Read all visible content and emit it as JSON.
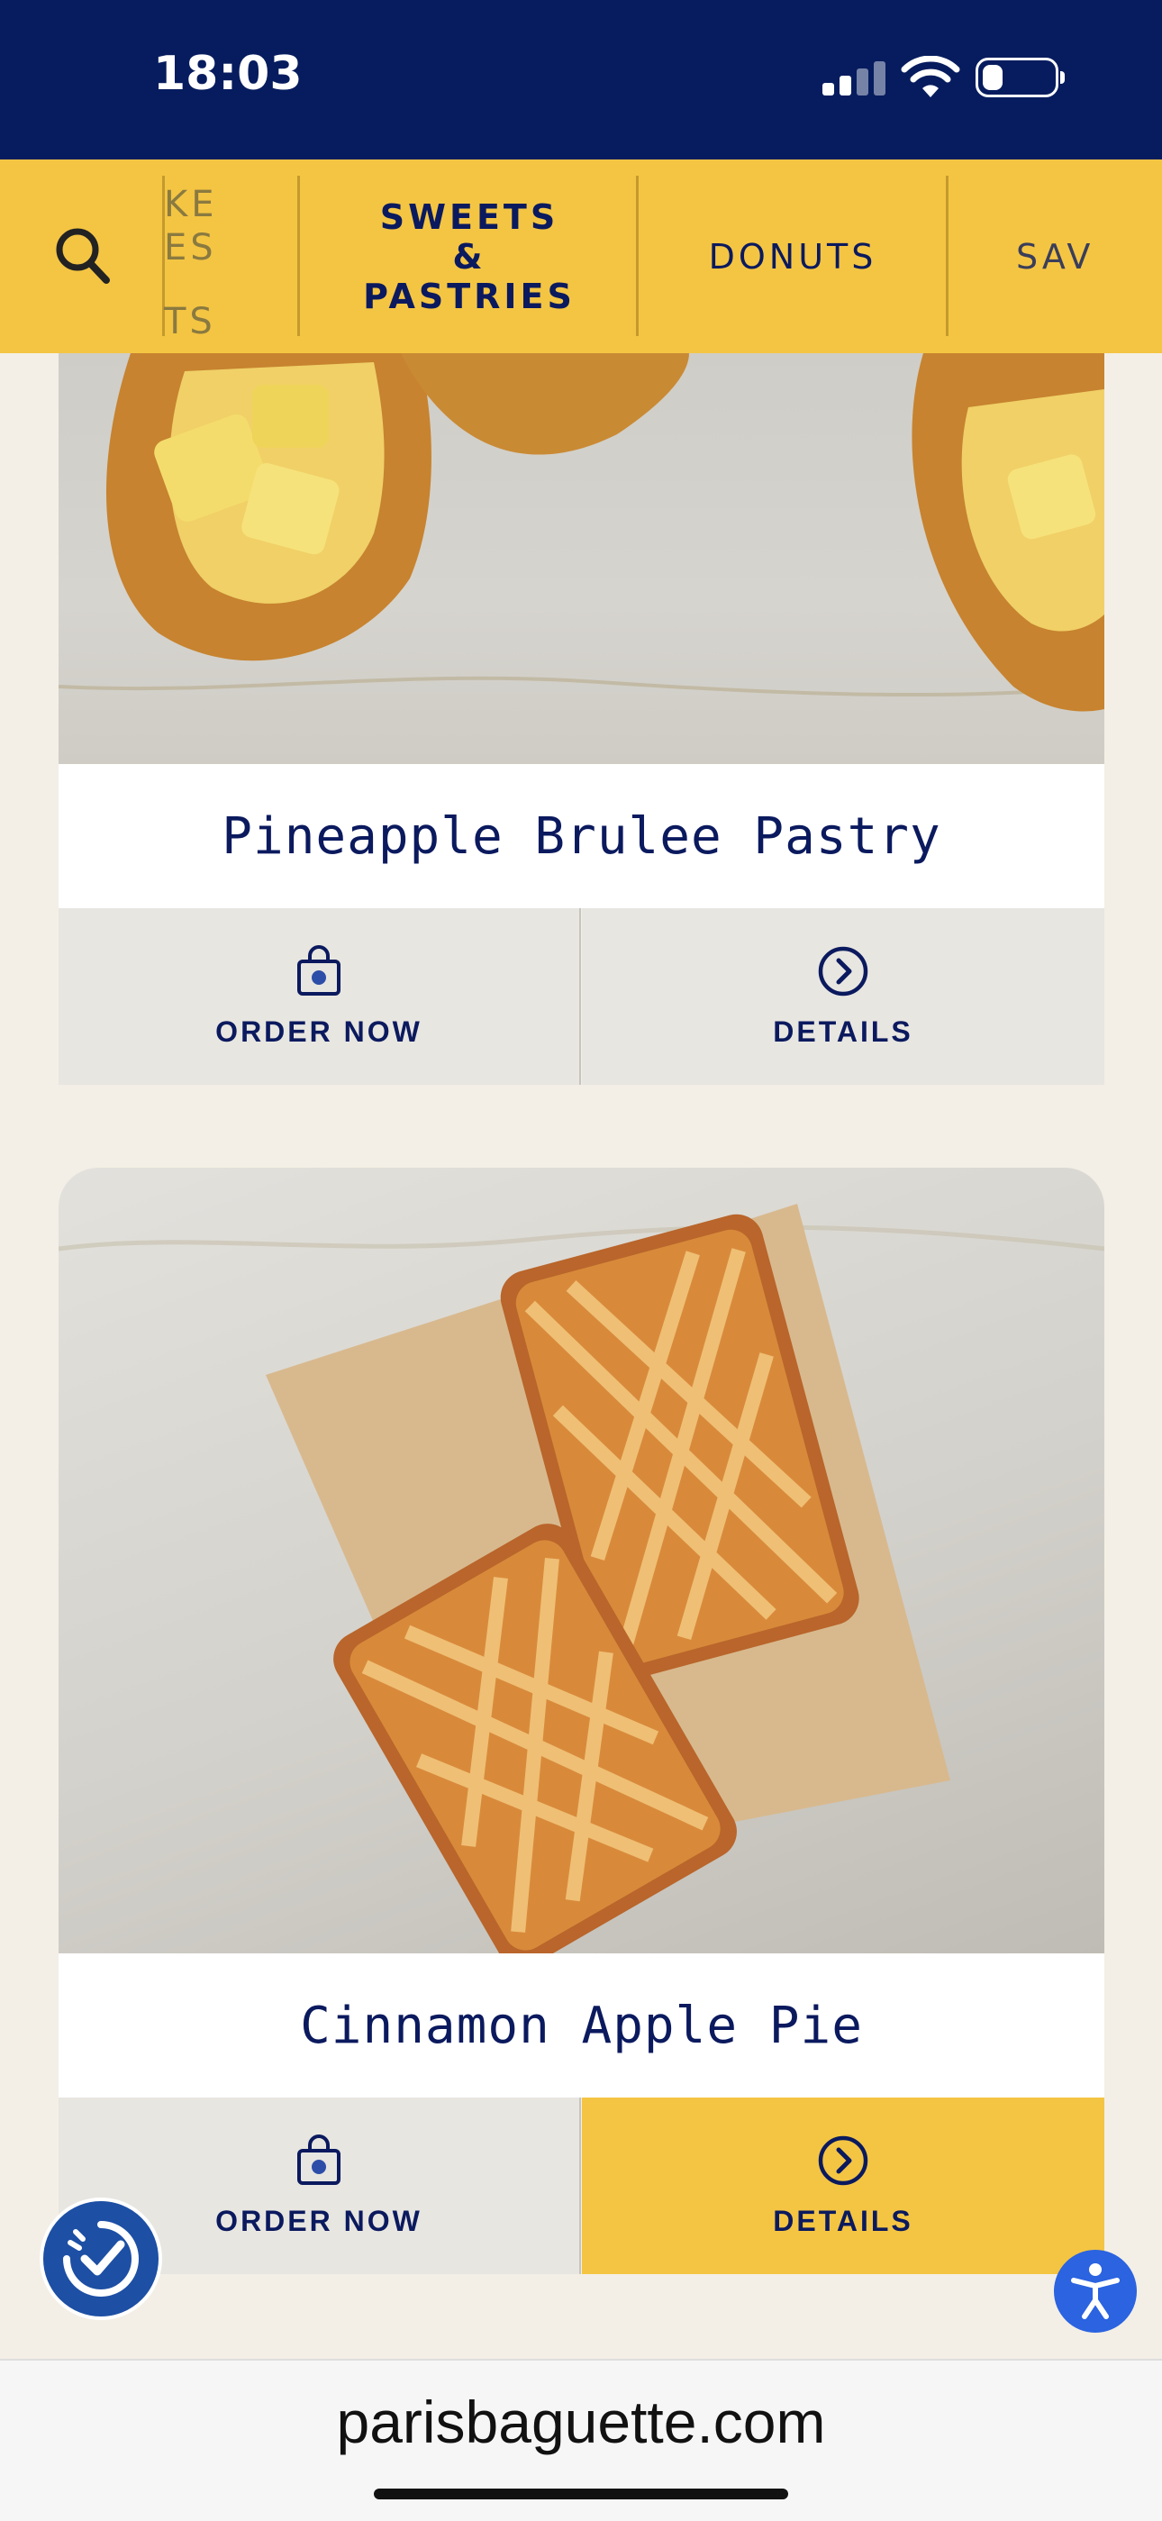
{
  "status_bar": {
    "time": "18:03"
  },
  "category_nav": {
    "search_icon": "search-icon",
    "partial_left_lines": [
      "KE",
      "ES",
      "",
      "TS"
    ],
    "active": "SWEETS\n&\nPASTRIES",
    "items": [
      "DONUTS",
      "SAV"
    ]
  },
  "products": [
    {
      "name": "Pineapple Brulee Pastry",
      "order_label": "ORDER NOW",
      "details_label": "DETAILS"
    },
    {
      "name": "Cinnamon Apple Pie",
      "order_label": "ORDER NOW",
      "details_label": "DETAILS"
    }
  ],
  "browser": {
    "url": "parisbaguette.com"
  },
  "colors": {
    "navy": "#061c5e",
    "brand_yellow": "#f4c543",
    "text_navy": "#0b1a5e"
  },
  "icons": [
    "search-icon",
    "shopping-bag-icon",
    "chevron-right-circle-icon",
    "rewards-icon",
    "accessibility-icon"
  ]
}
